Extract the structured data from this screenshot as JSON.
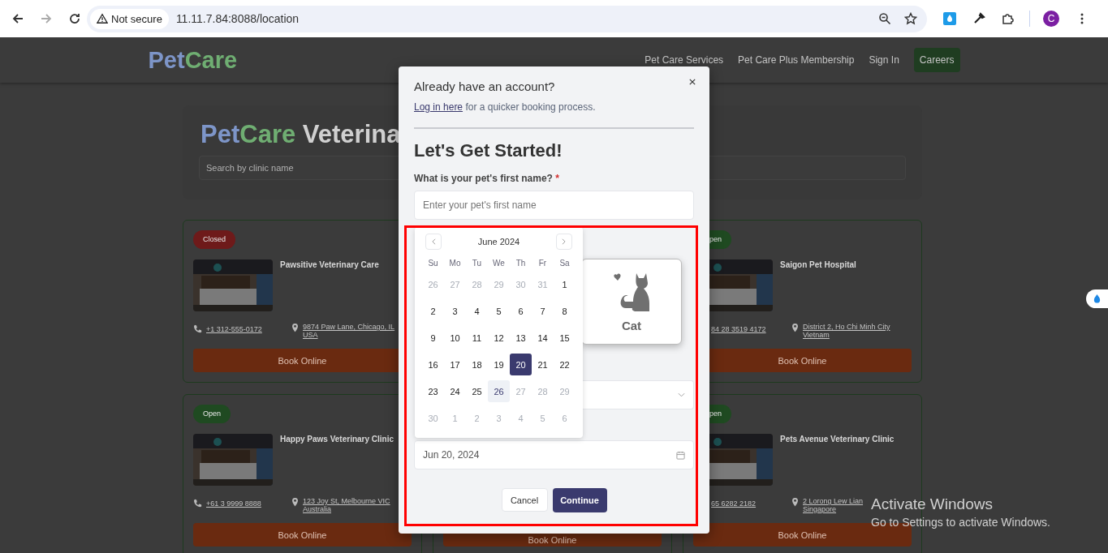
{
  "browser": {
    "security": "Not secure",
    "url": "11.11.7.84:8088/location",
    "avatar": "C"
  },
  "header": {
    "logo_a": "Pet",
    "logo_b": "Care",
    "nav": [
      {
        "label": "Pet Care Services",
        "kind": "link"
      },
      {
        "label": "Pet Care Plus Membership",
        "kind": "link"
      },
      {
        "label": "Sign In",
        "kind": "link"
      },
      {
        "label": "Careers",
        "kind": "button"
      }
    ]
  },
  "hero": {
    "title_a": "Pet",
    "title_b": "Care",
    "title_c": "Veterina",
    "search_placeholder": "Search by clinic name"
  },
  "clinic_rows": [
    {
      "left": {
        "status": "Closed",
        "open": false,
        "name": "Pawsitive Veterinary Care",
        "phone": "+1 312-555-0172",
        "address": [
          "9874 Paw Lane, Chicago, IL",
          "USA"
        ],
        "book": "Book Online"
      },
      "right": {
        "status": "pen",
        "open": true,
        "name": "Saigon Pet Hospital",
        "phone": "84 28 3519 4172",
        "address": [
          "District 2, Ho Chi Minh City",
          "Vietnam"
        ],
        "book": "Book Online"
      }
    },
    {
      "left": {
        "status": "Open",
        "open": true,
        "name": "Happy Paws Veterinary Clinic",
        "phone": "+61 3 9999 8888",
        "address": [
          "123 Joy St, Melbourne VIC",
          "Australia"
        ],
        "book": "Book Online"
      },
      "middle": {
        "book": "Book Online"
      },
      "right": {
        "status": "pen",
        "open": true,
        "name": "Pets Avenue Veterinary Clinic",
        "phone": "65 6282 2182",
        "address": [
          "2 Lorong Lew Lian",
          "Singapore"
        ],
        "book": "Book Online"
      }
    }
  ],
  "modal": {
    "account_title": "Already have an account?",
    "login_link": "Log in here",
    "login_rest": " for a quicker booking process.",
    "heading": "Let's Get Started!",
    "name_label": "What is your pet's first name?",
    "required_mark": "*",
    "name_placeholder": "Enter your pet's first name",
    "pet_type": {
      "label": "Cat",
      "selected": true
    },
    "date_value": "Jun 20, 2024",
    "cancel": "Cancel",
    "continue": "Continue"
  },
  "calendar": {
    "month": "June 2024",
    "weekdays": [
      "Su",
      "Mo",
      "Tu",
      "We",
      "Th",
      "Fr",
      "Sa"
    ],
    "weeks": [
      [
        {
          "label": "26",
          "muted": true,
          "selected": false,
          "today": false
        },
        {
          "label": "27",
          "muted": true,
          "selected": false,
          "today": false
        },
        {
          "label": "28",
          "muted": true,
          "selected": false,
          "today": false
        },
        {
          "label": "29",
          "muted": true,
          "selected": false,
          "today": false
        },
        {
          "label": "30",
          "muted": true,
          "selected": false,
          "today": false
        },
        {
          "label": "31",
          "muted": true,
          "selected": false,
          "today": false
        },
        {
          "label": "1",
          "muted": false,
          "selected": false,
          "today": false
        }
      ],
      [
        {
          "label": "2",
          "muted": false,
          "selected": false,
          "today": false
        },
        {
          "label": "3",
          "muted": false,
          "selected": false,
          "today": false
        },
        {
          "label": "4",
          "muted": false,
          "selected": false,
          "today": false
        },
        {
          "label": "5",
          "muted": false,
          "selected": false,
          "today": false
        },
        {
          "label": "6",
          "muted": false,
          "selected": false,
          "today": false
        },
        {
          "label": "7",
          "muted": false,
          "selected": false,
          "today": false
        },
        {
          "label": "8",
          "muted": false,
          "selected": false,
          "today": false
        }
      ],
      [
        {
          "label": "9",
          "muted": false,
          "selected": false,
          "today": false
        },
        {
          "label": "10",
          "muted": false,
          "selected": false,
          "today": false
        },
        {
          "label": "11",
          "muted": false,
          "selected": false,
          "today": false
        },
        {
          "label": "12",
          "muted": false,
          "selected": false,
          "today": false
        },
        {
          "label": "13",
          "muted": false,
          "selected": false,
          "today": false
        },
        {
          "label": "14",
          "muted": false,
          "selected": false,
          "today": false
        },
        {
          "label": "15",
          "muted": false,
          "selected": false,
          "today": false
        }
      ],
      [
        {
          "label": "16",
          "muted": false,
          "selected": false,
          "today": false
        },
        {
          "label": "17",
          "muted": false,
          "selected": false,
          "today": false
        },
        {
          "label": "18",
          "muted": false,
          "selected": false,
          "today": false
        },
        {
          "label": "19",
          "muted": false,
          "selected": false,
          "today": false
        },
        {
          "label": "20",
          "muted": false,
          "selected": true,
          "today": false
        },
        {
          "label": "21",
          "muted": false,
          "selected": false,
          "today": false
        },
        {
          "label": "22",
          "muted": false,
          "selected": false,
          "today": false
        }
      ],
      [
        {
          "label": "23",
          "muted": false,
          "selected": false,
          "today": false
        },
        {
          "label": "24",
          "muted": false,
          "selected": false,
          "today": false
        },
        {
          "label": "25",
          "muted": false,
          "selected": false,
          "today": false
        },
        {
          "label": "26",
          "muted": false,
          "selected": false,
          "today": true
        },
        {
          "label": "27",
          "muted": true,
          "selected": false,
          "today": false
        },
        {
          "label": "28",
          "muted": true,
          "selected": false,
          "today": false
        },
        {
          "label": "29",
          "muted": true,
          "selected": false,
          "today": false
        }
      ],
      [
        {
          "label": "30",
          "muted": true,
          "selected": false,
          "today": false
        },
        {
          "label": "1",
          "muted": true,
          "selected": false,
          "today": false
        },
        {
          "label": "2",
          "muted": true,
          "selected": false,
          "today": false
        },
        {
          "label": "3",
          "muted": true,
          "selected": false,
          "today": false
        },
        {
          "label": "4",
          "muted": true,
          "selected": false,
          "today": false
        },
        {
          "label": "5",
          "muted": true,
          "selected": false,
          "today": false
        },
        {
          "label": "6",
          "muted": true,
          "selected": false,
          "today": false
        }
      ]
    ]
  },
  "os_notice": {
    "title": "Activate Windows",
    "subtitle": "Go to Settings to activate Windows."
  }
}
